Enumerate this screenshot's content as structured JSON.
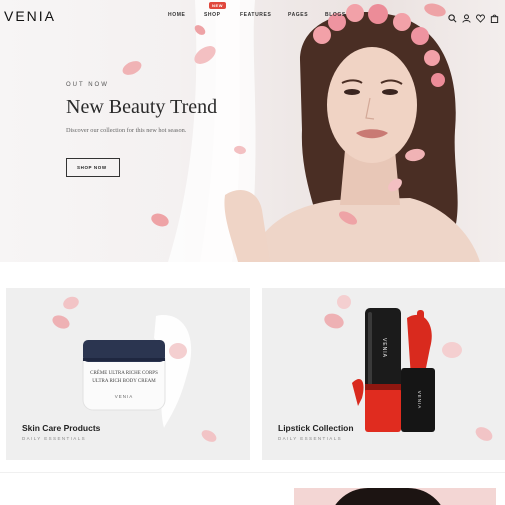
{
  "header": {
    "logo": "VENIA",
    "nav": {
      "home": "HOME",
      "shop": "SHOP",
      "shop_badge": "NEW",
      "features": "FEATURES",
      "pages": "PAGES",
      "blogs": "BLOGS"
    },
    "icons": [
      "search-icon",
      "user-icon",
      "heart-icon",
      "bag-icon"
    ]
  },
  "hero": {
    "eyebrow": "OUT NOW",
    "title": "New Beauty Trend",
    "subtitle": "Discover our collection for this new hot season.",
    "button_label": "SHOP NOW"
  },
  "cards": [
    {
      "title": "Skin Care Products",
      "subtitle": "DAILY ESSENTIALS",
      "jar_label_1": "CRÈME ULTRA RICHE CORPS",
      "jar_label_2": "ULTRA RICH BODY CREAM",
      "jar_brand": "VENIA"
    },
    {
      "title": "Lipstick Collection",
      "subtitle": "DAILY ESSENTIALS",
      "tube_brand": "VENIA"
    }
  ],
  "colors": {
    "accent_red": "#e0483d",
    "card_bg": "#efefef",
    "petal": "#e9a5a8"
  }
}
